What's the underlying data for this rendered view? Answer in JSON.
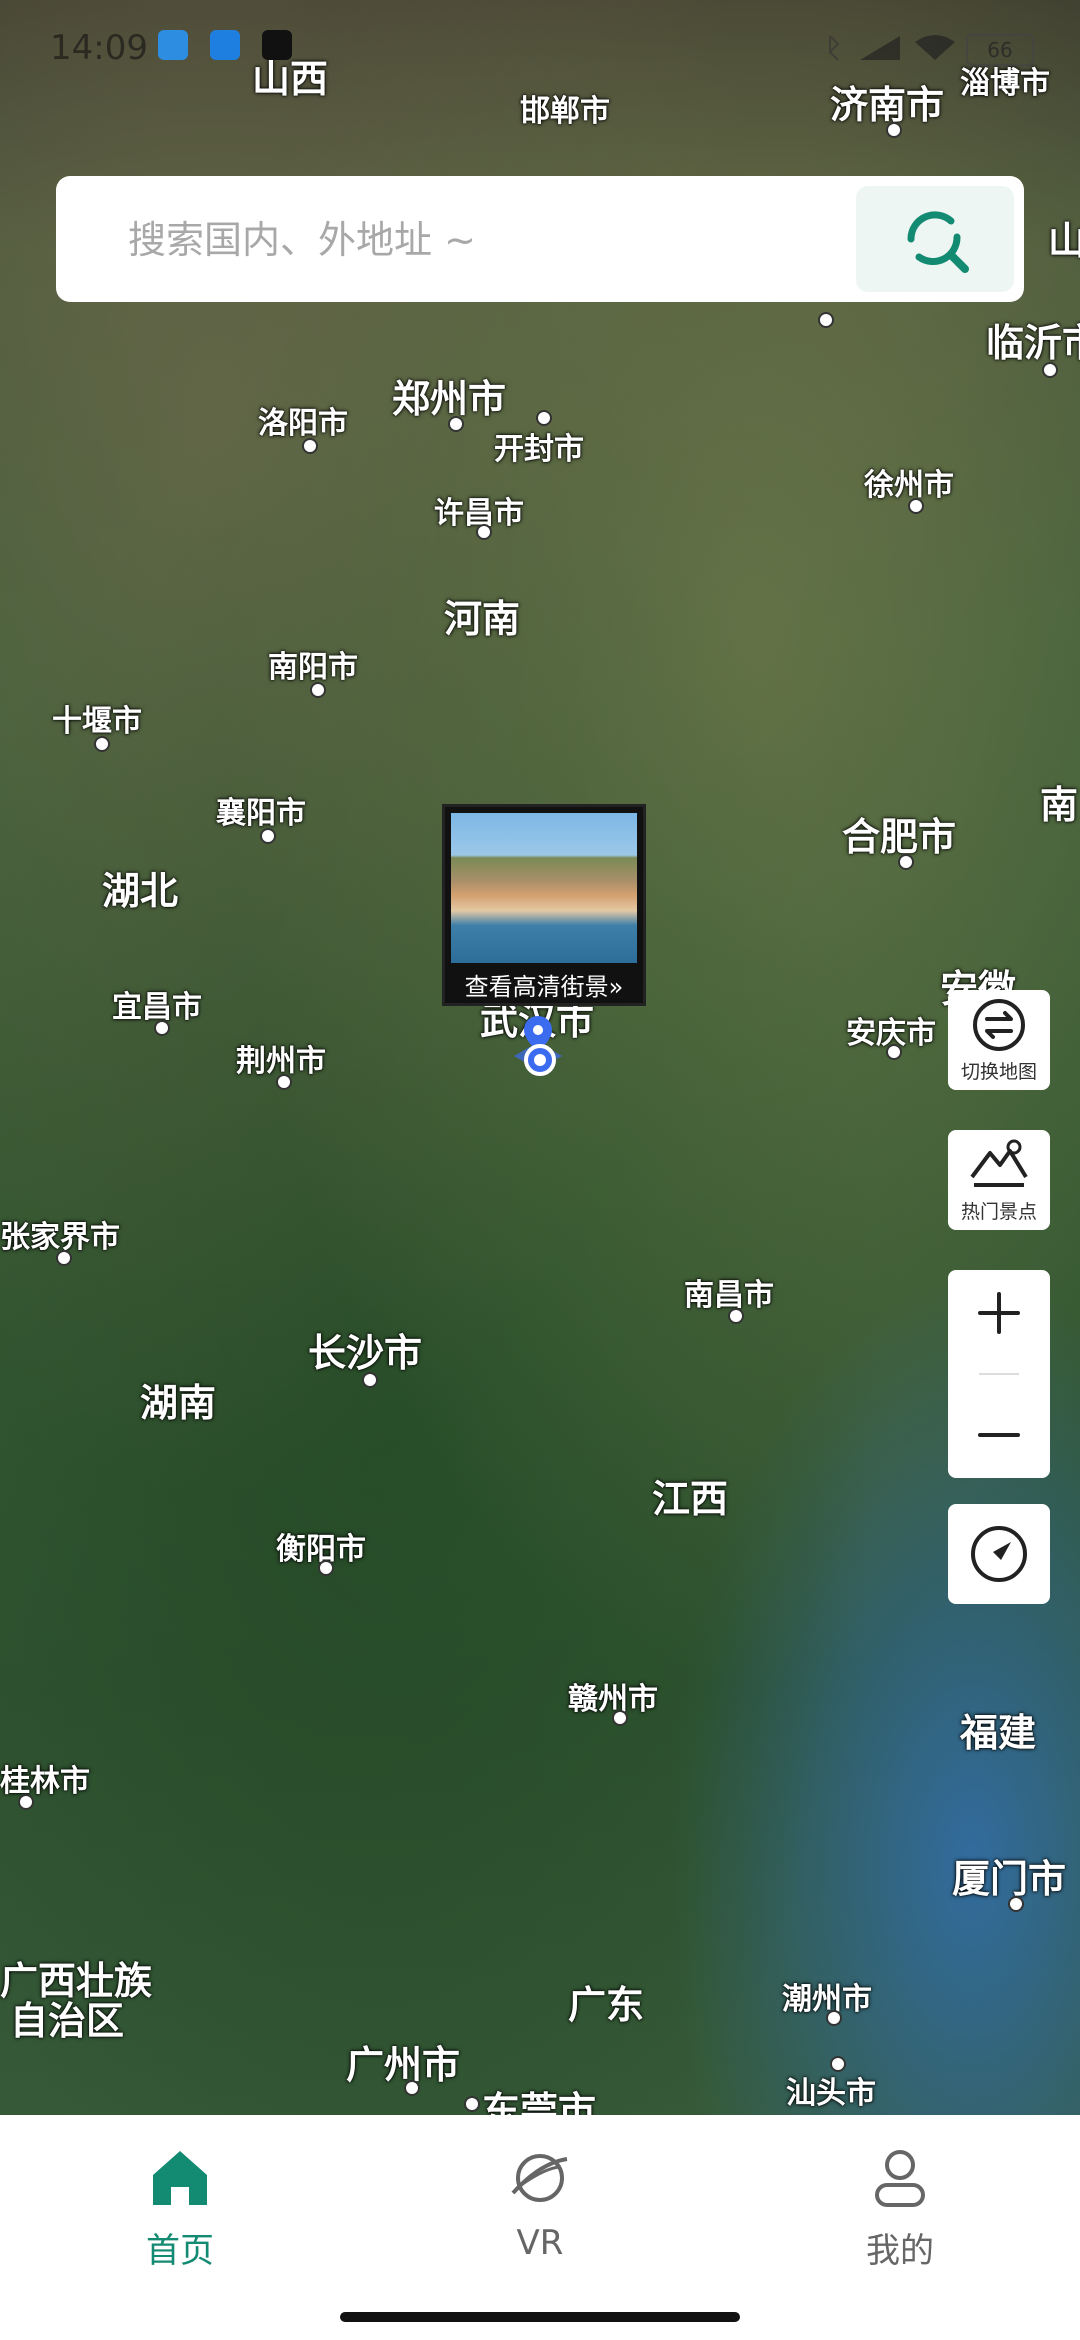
{
  "status_bar": {
    "time": "14:09",
    "battery": "66"
  },
  "search": {
    "placeholder": "搜索国内、外地址 ~"
  },
  "map_labels": [
    {
      "id": "shanxi",
      "text": "山西"
    },
    {
      "id": "handan",
      "text": "邯郸市"
    },
    {
      "id": "jinan",
      "text": "济南市"
    },
    {
      "id": "zibo",
      "text": "淄博市"
    },
    {
      "id": "shan",
      "text": "山"
    },
    {
      "id": "linyi",
      "text": "临沂市"
    },
    {
      "id": "zhengzhou",
      "text": "郑州市"
    },
    {
      "id": "luoyang",
      "text": "洛阳市"
    },
    {
      "id": "kaifeng",
      "text": "开封市"
    },
    {
      "id": "xuchang",
      "text": "许昌市"
    },
    {
      "id": "xuzhou",
      "text": "徐州市"
    },
    {
      "id": "henan",
      "text": "河南"
    },
    {
      "id": "nanyang",
      "text": "南阳市"
    },
    {
      "id": "shiyan",
      "text": "十堰市"
    },
    {
      "id": "xiangyang",
      "text": "襄阳市"
    },
    {
      "id": "hefei",
      "text": "合肥市"
    },
    {
      "id": "nan",
      "text": "南"
    },
    {
      "id": "hubei",
      "text": "湖北"
    },
    {
      "id": "yichang",
      "text": "宜昌市"
    },
    {
      "id": "jingzhou",
      "text": "荆州市"
    },
    {
      "id": "wuhan",
      "text": "武汉市"
    },
    {
      "id": "anqing",
      "text": "安庆市"
    },
    {
      "id": "anhui",
      "text": "安徽"
    },
    {
      "id": "zhangjiajie",
      "text": "张家界市"
    },
    {
      "id": "nanchang",
      "text": "南昌市"
    },
    {
      "id": "changsha",
      "text": "长沙市"
    },
    {
      "id": "hunan",
      "text": "湖南"
    },
    {
      "id": "jiangxi",
      "text": "江西"
    },
    {
      "id": "hengyang",
      "text": "衡阳市"
    },
    {
      "id": "ganzhou",
      "text": "赣州市"
    },
    {
      "id": "fujian",
      "text": "福建"
    },
    {
      "id": "guilin",
      "text": "桂林市"
    },
    {
      "id": "xiamen",
      "text": "厦门市"
    },
    {
      "id": "guangxi1",
      "text": "广西壮族"
    },
    {
      "id": "guangxi2",
      "text": "自治区"
    },
    {
      "id": "guangdong",
      "text": "广东"
    },
    {
      "id": "chaozhou",
      "text": "潮州市"
    },
    {
      "id": "guangzhou",
      "text": "广州市"
    },
    {
      "id": "dongguan",
      "text": "东莞市"
    },
    {
      "id": "shantou",
      "text": "汕头市"
    }
  ],
  "popup": {
    "label": "查看高清街景»"
  },
  "side_buttons": {
    "switch_map": "切换地图",
    "hot_spots": "热门景点"
  },
  "tabs": [
    {
      "label": "首页",
      "active": true
    },
    {
      "label": "VR",
      "active": false
    },
    {
      "label": "我的",
      "active": false
    }
  ],
  "colors": {
    "accent": "#138a72",
    "tab_inactive": "#666666"
  }
}
